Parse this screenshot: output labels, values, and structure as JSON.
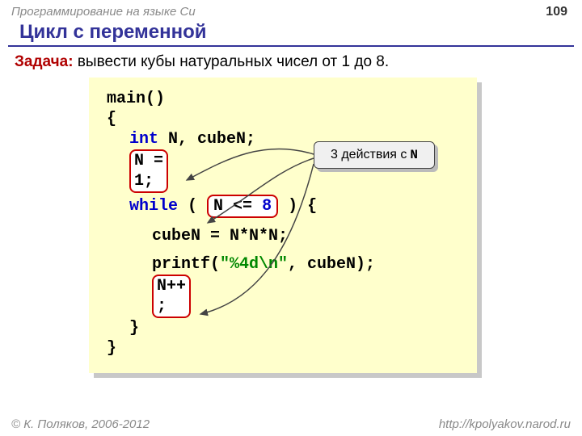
{
  "header": {
    "course": "Программирование на языке Си",
    "page": "109"
  },
  "title": "Цикл с переменной",
  "task": {
    "label": "Задача:",
    "text": " вывести кубы натуральных чисел от 1 до 8."
  },
  "code": {
    "main": "main()",
    "open": "{",
    "decl_kw": "int",
    "decl_rest": " N, cubeN;",
    "init1": "N = ",
    "init2": "1;",
    "while_kw": "while",
    "while_open": " ( ",
    "cond_var": "N",
    "cond_op": " <= ",
    "cond_val": "8",
    "while_close": " ) {",
    "cube": "cubeN = N*N*N;",
    "printf": "printf(",
    "fmt": "\"%4d\\n\"",
    "printf_tail": ", cubeN);",
    "inc1": "N++",
    "inc2": ";",
    "close1": "}",
    "close2": "}"
  },
  "callout": {
    "text": "3 действия с ",
    "var": "N"
  },
  "footer": {
    "left": "© К. Поляков, 2006-2012",
    "right": "http://kpolyakov.narod.ru"
  }
}
